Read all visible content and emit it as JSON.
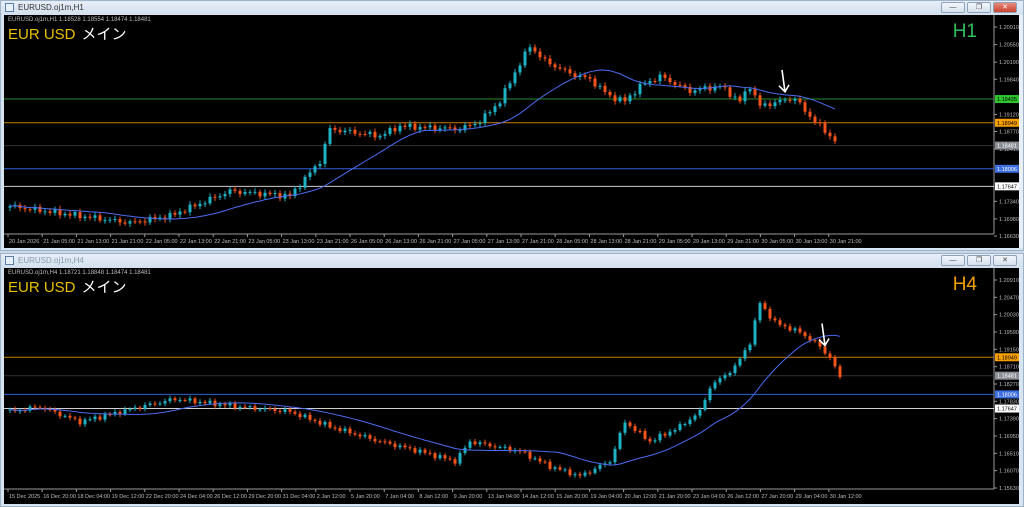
{
  "colors": {
    "bull": "#1fb2c4",
    "bear": "#f2541b",
    "ma": "#4a6cf2",
    "axis": "#9a9a9a",
    "text": "#bdbdbd",
    "h1": "#2fbf5a",
    "h4": "#f0a000",
    "symbol": "#e8c000"
  },
  "window_buttons": {
    "minimize": "—",
    "restore": "❐",
    "close": "✕"
  },
  "charts": [
    {
      "window_title": "EURUSD.oj1m,H1",
      "header": "EURUSD.oj1m,H1  1.18528 1.18554 1.18474 1.18481",
      "symbol": "EUR USD",
      "label": "メイン",
      "timeframe": "H1",
      "price_ticks": [
        "1.20910",
        "1.20550",
        "1.20190",
        "1.19840",
        "1.19120",
        "1.18770",
        "1.18410",
        "1.17340",
        "1.16980",
        "1.16630"
      ],
      "levels": [
        {
          "price": "1.19435",
          "color": "#2a8a2a",
          "tag": "#2ec42e",
          "tagText": "#000"
        },
        {
          "price": "1.18949",
          "color": "#c77a00",
          "tag": "#f5a000",
          "tagText": "#000"
        },
        {
          "price": "1.18481",
          "color": "#333333",
          "tag": "#8a8f96",
          "tagText": "#fff"
        },
        {
          "price": "1.18006",
          "color": "#2f5fd8",
          "tag": "#3c6ee0",
          "tagText": "#fff"
        },
        {
          "price": "1.17647",
          "color": "#cfcfcf",
          "tag": "#ffffff",
          "tagText": "#000"
        }
      ],
      "time_labels": [
        "20 Jan 2026",
        "21 Jan 05:00",
        "21 Jan 13:00",
        "21 Jan 21:00",
        "22 Jan 05:00",
        "22 Jan 13:00",
        "22 Jan 21:00",
        "23 Jan 05:00",
        "23 Jan 13:00",
        "23 Jan 21:00",
        "26 Jan 05:00",
        "26 Jan 13:00",
        "26 Jan 21:00",
        "27 Jan 05:00",
        "27 Jan 13:00",
        "27 Jan 21:00",
        "28 Jan 05:00",
        "28 Jan 13:00",
        "28 Jan 21:00",
        "29 Jan 05:00",
        "29 Jan 13:00",
        "29 Jan 21:00",
        "30 Jan 05:00",
        "30 Jan 13:00",
        "30 Jan 21:00"
      ],
      "price_path": [
        [
          0,
          1.1724
        ],
        [
          24,
          1.169
        ],
        [
          32,
          1.1704
        ],
        [
          44,
          1.1755
        ],
        [
          56,
          1.1745
        ],
        [
          62,
          1.1816
        ],
        [
          64,
          1.1882
        ],
        [
          74,
          1.1868
        ],
        [
          78,
          1.1888
        ],
        [
          90,
          1.1882
        ],
        [
          94,
          1.1898
        ],
        [
          98,
          1.1939
        ],
        [
          101,
          1.1998
        ],
        [
          104,
          1.2052
        ],
        [
          107,
          1.2021
        ],
        [
          112,
          1.1996
        ],
        [
          116,
          1.1984
        ],
        [
          120,
          1.1949
        ],
        [
          123,
          1.1939
        ],
        [
          126,
          1.197
        ],
        [
          130,
          1.199
        ],
        [
          136,
          1.196
        ],
        [
          142,
          1.197
        ],
        [
          146,
          1.1939
        ],
        [
          148,
          1.197
        ],
        [
          150,
          1.1929
        ],
        [
          154,
          1.1939
        ],
        [
          157,
          1.1945
        ],
        [
          159,
          1.1919
        ],
        [
          162,
          1.1888
        ],
        [
          165,
          1.1857
        ]
      ],
      "arrow_bar": 155
    },
    {
      "window_title": "EURUSD.oj1m,H4",
      "header": "EURUSD.oj1m,H4  1.18721 1.18848 1.18474 1.18481",
      "symbol": "EUR USD",
      "label": "メイン",
      "timeframe": "H4",
      "price_ticks": [
        "1.20910",
        "1.20470",
        "1.20030",
        "1.19590",
        "1.19150",
        "1.18710",
        "1.18270",
        "1.17830",
        "1.17390",
        "1.16950",
        "1.16510",
        "1.16070",
        "1.15630"
      ],
      "levels": [
        {
          "price": "1.18949",
          "color": "#c77a00",
          "tag": "#f5a000",
          "tagText": "#000"
        },
        {
          "price": "1.18481",
          "color": "#333333",
          "tag": "#8a8f96",
          "tagText": "#fff"
        },
        {
          "price": "1.18006",
          "color": "#2f5fd8",
          "tag": "#3c6ee0",
          "tagText": "#fff"
        },
        {
          "price": "1.17647",
          "color": "#cfcfcf",
          "tag": "#ffffff",
          "tagText": "#000"
        }
      ],
      "time_labels": [
        "15 Dec 2025",
        "16 Dec 20:00",
        "18 Dec 04:00",
        "19 Dec 12:00",
        "22 Dec 20:00",
        "24 Dec 04:00",
        "26 Dec 12:00",
        "29 Dec 20:00",
        "31 Dec 04:00",
        "2 Jan 12:00",
        "5 Jan 20:00",
        "7 Jan 04:00",
        "8 Jan 12:00",
        "9 Jan 20:00",
        "13 Jan 04:00",
        "14 Jan 12:00",
        "15 Jan 20:00",
        "19 Jan 04:00",
        "20 Jan 12:00",
        "21 Jan 20:00",
        "23 Jan 04:00",
        "26 Jan 12:00",
        "27 Jan 20:00",
        "29 Jan 04:00",
        "30 Jan 12:00"
      ],
      "price_path": [
        [
          0,
          1.1757
        ],
        [
          6,
          1.1769
        ],
        [
          14,
          1.1731
        ],
        [
          26,
          1.1769
        ],
        [
          33,
          1.1789
        ],
        [
          46,
          1.1769
        ],
        [
          56,
          1.1757
        ],
        [
          64,
          1.1719
        ],
        [
          74,
          1.1681
        ],
        [
          82,
          1.1656
        ],
        [
          89,
          1.1631
        ],
        [
          92,
          1.1681
        ],
        [
          102,
          1.1656
        ],
        [
          108,
          1.1618
        ],
        [
          114,
          1.1593
        ],
        [
          120,
          1.1631
        ],
        [
          123,
          1.1731
        ],
        [
          128,
          1.1681
        ],
        [
          134,
          1.1719
        ],
        [
          138,
          1.1757
        ],
        [
          140,
          1.1819
        ],
        [
          145,
          1.187
        ],
        [
          148,
          1.1933
        ],
        [
          150,
          1.2033
        ],
        [
          153,
          1.1983
        ],
        [
          158,
          1.1958
        ],
        [
          161,
          1.1933
        ],
        [
          164,
          1.1895
        ],
        [
          166,
          1.1845
        ]
      ],
      "arrow_bar": 163
    }
  ]
}
